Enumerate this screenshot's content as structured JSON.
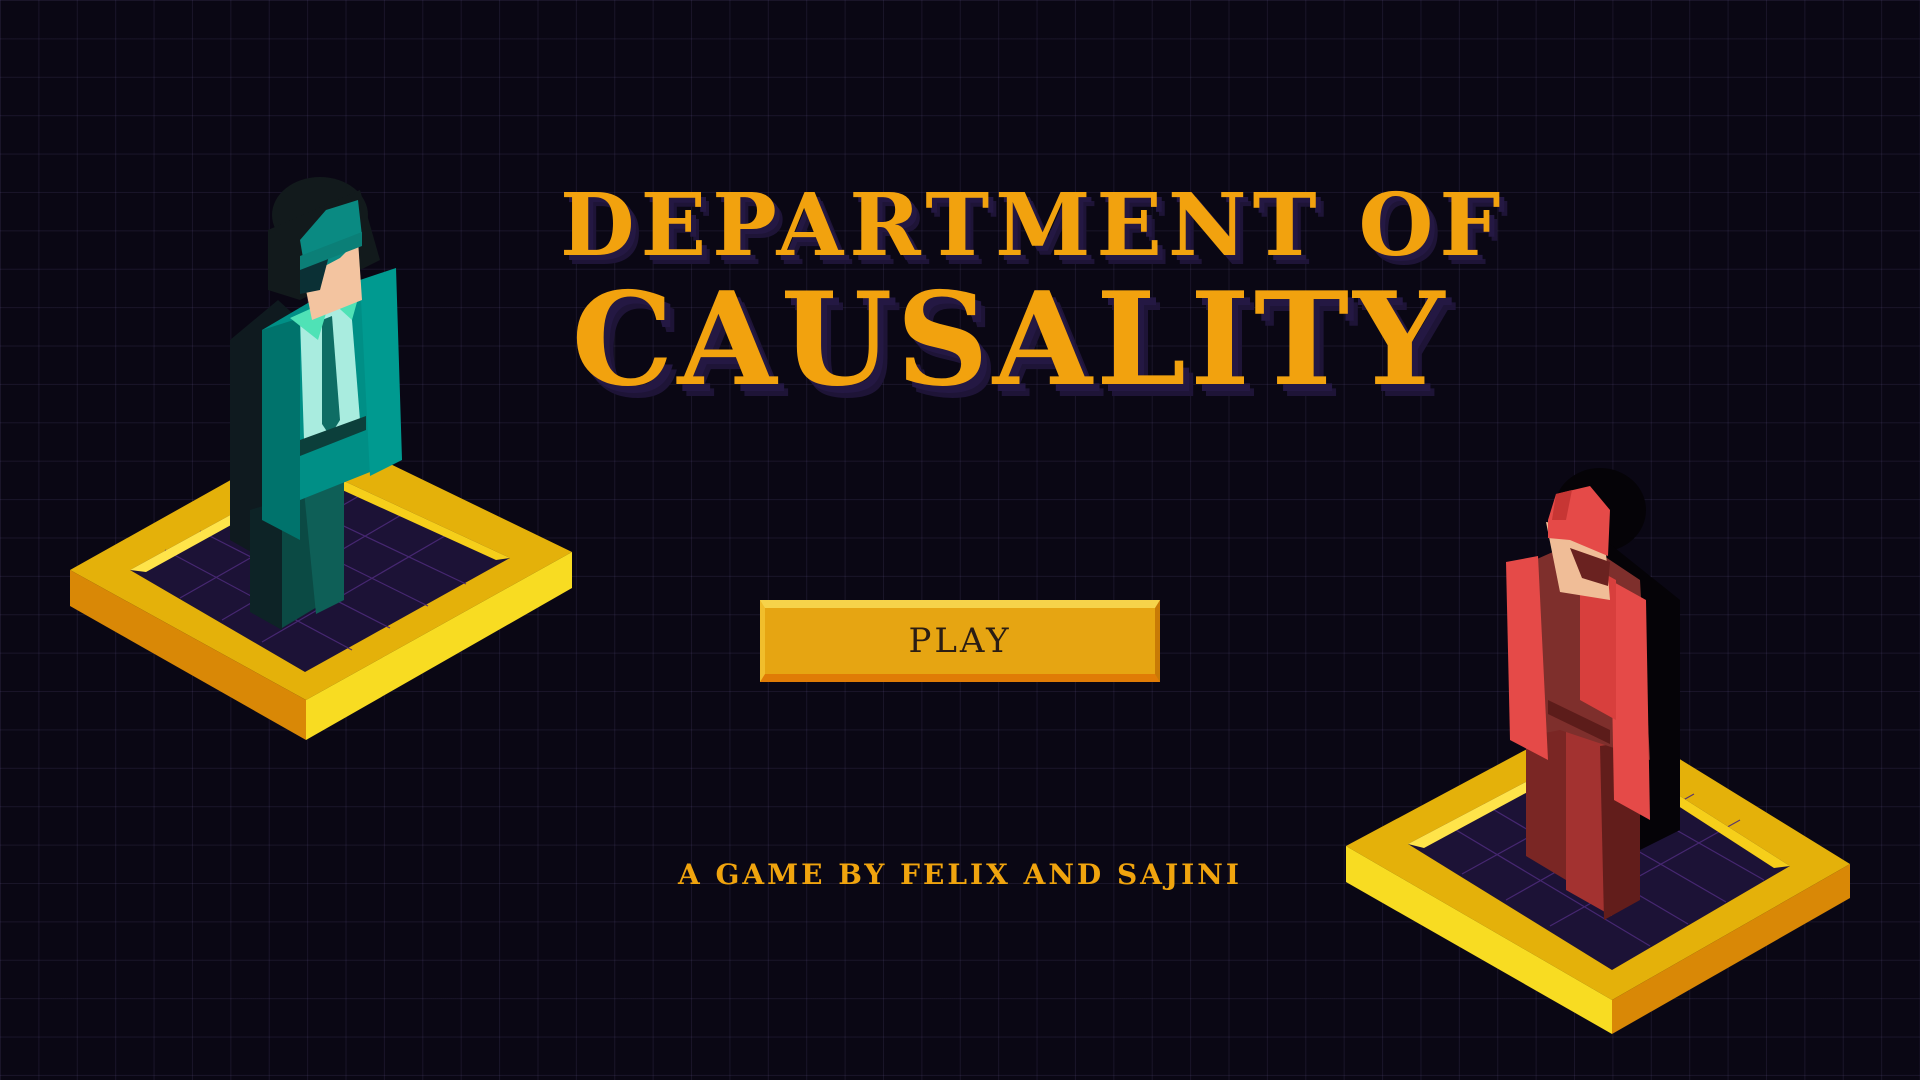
{
  "title": {
    "line1": "DEPARTMENT OF",
    "line2": "CAUSALITY"
  },
  "menu": {
    "play_label": "PLAY"
  },
  "credits": "A GAME BY FELIX AND SAJINI",
  "characters": [
    {
      "name": "teal-agent",
      "outfit_color": "#009188",
      "shirt_color": "#a8ebde"
    },
    {
      "name": "red-agent",
      "outfit_color": "#e54a48",
      "shirt_color": "#7e2f2c"
    }
  ],
  "colors": {
    "background": "#0a0714",
    "title": "#f2a20e",
    "title_shadow": "#241843",
    "platform_frame": "#e8b10a",
    "platform_floor": "#1e1437",
    "button": "#e6a512"
  }
}
